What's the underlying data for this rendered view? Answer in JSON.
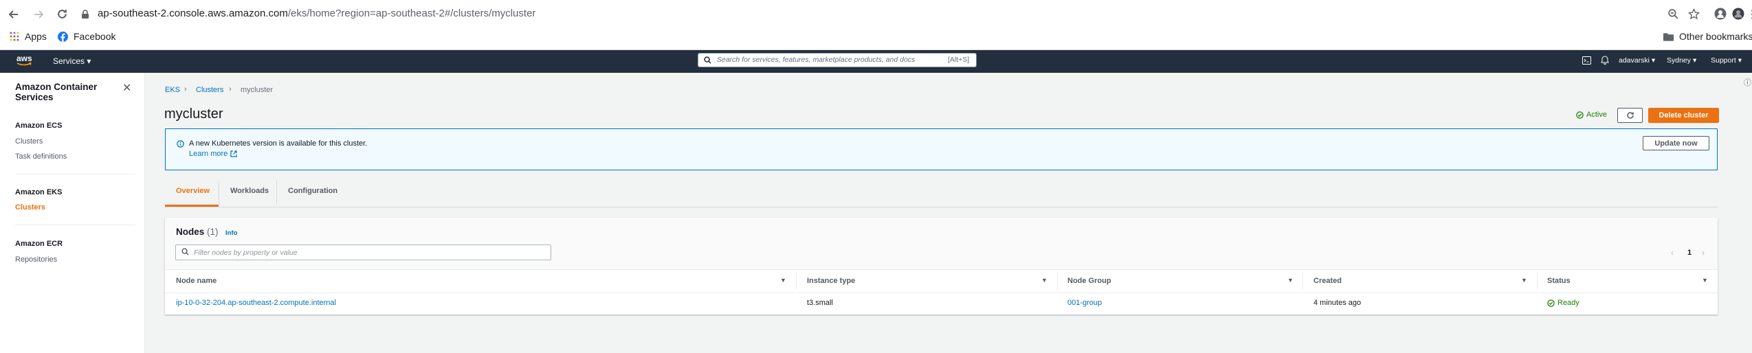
{
  "browser": {
    "url_host": "ap-southeast-2.console.aws.amazon.com",
    "url_path": "/eks/home?region=ap-southeast-2#/clusters/mycluster",
    "bookmarks": [
      "Apps",
      "Facebook"
    ],
    "other_bookmarks": "Other bookmarks"
  },
  "awsnav": {
    "logo": "aws",
    "services": "Services",
    "search_placeholder": "Search for services, features, marketplace products, and docs",
    "search_shortcut": "[Alt+S]",
    "user": "adavarski",
    "region": "Sydney",
    "support": "Support"
  },
  "sidebar": {
    "title": "Amazon Container Services",
    "sections": [
      {
        "heading": "Amazon ECS",
        "items": [
          "Clusters",
          "Task definitions"
        ]
      },
      {
        "heading": "Amazon EKS",
        "items": [
          "Clusters"
        ]
      },
      {
        "heading": "Amazon ECR",
        "items": [
          "Repositories"
        ]
      }
    ]
  },
  "breadcrumb": [
    "EKS",
    "Clusters",
    "mycluster"
  ],
  "page": {
    "title": "mycluster",
    "status": "Active",
    "delete_label": "Delete cluster"
  },
  "flash": {
    "message": "A new Kubernetes version is available for this cluster.",
    "link": "Learn more",
    "button": "Update now"
  },
  "tabs": [
    "Overview",
    "Workloads",
    "Configuration"
  ],
  "nodes": {
    "title": "Nodes",
    "count": "(1)",
    "info": "Info",
    "filter_placeholder": "Filter nodes by property or value",
    "page": "1",
    "columns": [
      "Node name",
      "Instance type",
      "Node Group",
      "Created",
      "Status"
    ],
    "rows": [
      {
        "name": "ip-10-0-32-204.ap-southeast-2.compute.internal",
        "instance_type": "t3.small",
        "node_group": "001-group",
        "created": "4 minutes ago",
        "status": "Ready"
      }
    ]
  },
  "colors": {
    "accent": "#ec7211",
    "link": "#0073bb",
    "success": "#1d8102",
    "nav_bg": "#232f3e"
  }
}
